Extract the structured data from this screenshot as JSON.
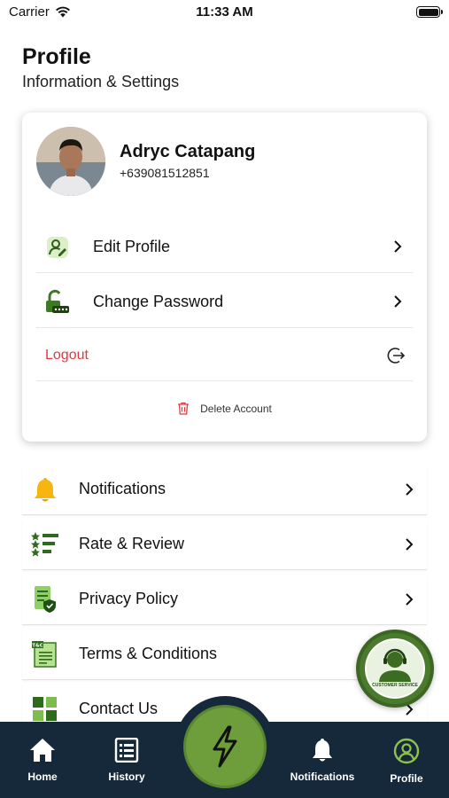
{
  "status_bar": {
    "carrier": "Carrier",
    "time": "11:33 AM"
  },
  "header": {
    "title": "Profile",
    "subtitle": "Information & Settings"
  },
  "profile": {
    "name": "Adryc Catapang",
    "phone": "+639081512851",
    "actions": [
      {
        "label": "Edit Profile",
        "icon": "edit-user-icon"
      },
      {
        "label": "Change Password",
        "icon": "unlock-password-icon"
      }
    ],
    "logout_label": "Logout",
    "delete_label": "Delete Account"
  },
  "menu": [
    {
      "label": "Notifications",
      "icon": "bell-icon"
    },
    {
      "label": "Rate & Review",
      "icon": "star-rating-icon"
    },
    {
      "label": "Privacy Policy",
      "icon": "privacy-shield-icon"
    },
    {
      "label": "Terms & Conditions",
      "icon": "terms-document-icon"
    },
    {
      "label": "Contact Us",
      "icon": "contact-grid-icon"
    }
  ],
  "customer_service": {
    "text": "CUSTOMER SERVICE"
  },
  "tabs": [
    {
      "label": "Home",
      "icon": "home-icon"
    },
    {
      "label": "History",
      "icon": "history-list-icon"
    },
    {
      "label": "Notifications",
      "icon": "bell-icon"
    },
    {
      "label": "Profile",
      "icon": "profile-icon",
      "active": true
    }
  ],
  "colors": {
    "accent_green": "#6e9d3c",
    "tab_bar": "#15293b",
    "logout_red": "#e0383e",
    "profile_tab_icon": "#8fc24a"
  }
}
